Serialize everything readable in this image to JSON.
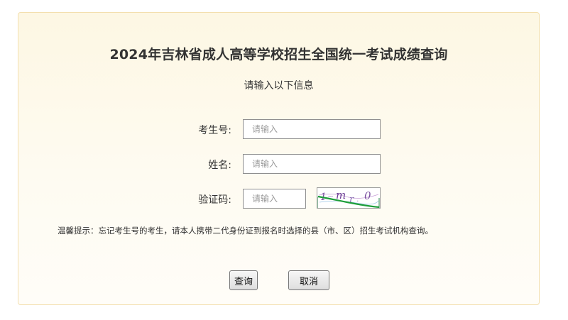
{
  "form": {
    "title": "2024年吉林省成人高等学校招生全国统一考试成绩查询",
    "subtitle": "请输入以下信息",
    "fields": {
      "exam_number": {
        "label": "考生号:",
        "placeholder": "请输入",
        "value": ""
      },
      "name": {
        "label": "姓名:",
        "placeholder": "请输入",
        "value": ""
      },
      "captcha": {
        "label": "验证码:",
        "placeholder": "请输入",
        "value": "",
        "image_text": "1 m r 0"
      }
    },
    "tip": "温馨提示：忘记考生号的考生，请本人携带二代身份证到报名时选择的县（市、区）招生考试机构查询。",
    "buttons": {
      "query": "查询",
      "cancel": "取消"
    }
  },
  "colors": {
    "panel_border": "#f3dfae",
    "panel_bg_top": "#fdf7e3",
    "text": "#333333",
    "captcha_line": "#1e9e3a"
  }
}
